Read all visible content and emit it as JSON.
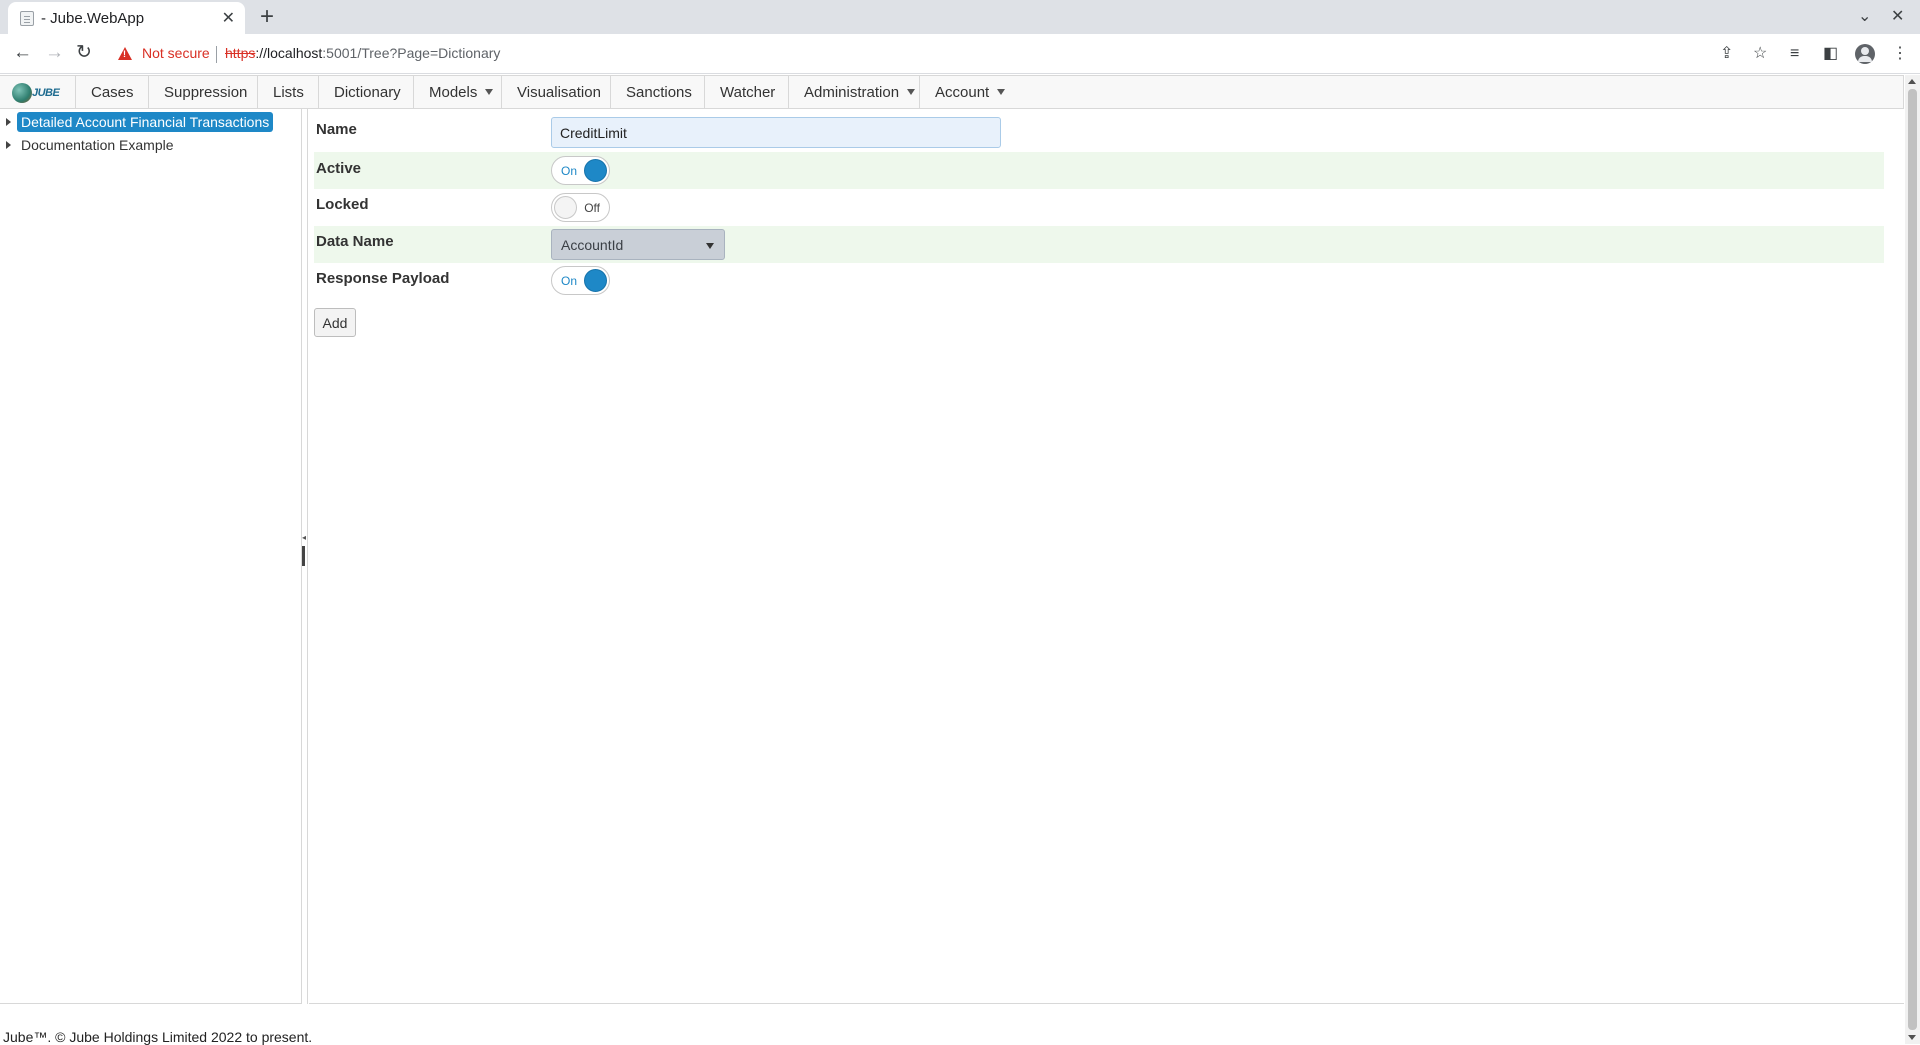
{
  "browser": {
    "tab_title": "- Jube.WebApp",
    "tab_close": "✕",
    "new_tab": "+",
    "not_secure": "Not secure",
    "url_scheme": "https",
    "url_host": "://localhost",
    "url_rest": ":5001/Tree?Page=Dictionary",
    "minimize": "⌄",
    "close": "✕"
  },
  "nav": {
    "logo_text": "JUBE",
    "items": [
      {
        "label": "Cases"
      },
      {
        "label": "Suppression"
      },
      {
        "label": "Lists"
      },
      {
        "label": "Dictionary"
      },
      {
        "label": "Models"
      },
      {
        "label": "Visualisation"
      },
      {
        "label": "Sanctions"
      },
      {
        "label": "Watcher"
      },
      {
        "label": "Administration"
      },
      {
        "label": "Account"
      }
    ]
  },
  "tree": {
    "nodes": [
      {
        "label": "Detailed Account Financial Transactions",
        "selected": true
      },
      {
        "label": "Documentation Example",
        "selected": false
      }
    ]
  },
  "form": {
    "name_label": "Name",
    "name_value": "CreditLimit",
    "active_label": "Active",
    "active_state": "On",
    "locked_label": "Locked",
    "locked_state": "Off",
    "data_name_label": "Data Name",
    "data_name_value": "AccountId",
    "response_payload_label": "Response Payload",
    "response_payload_state": "On",
    "add_button": "Add"
  },
  "footer": {
    "text": "Jube™. © Jube Holdings Limited 2022 to present."
  },
  "colors": {
    "accent": "#1e88c7",
    "row_highlight": "#eef8ec",
    "not_secure": "#d93025"
  }
}
